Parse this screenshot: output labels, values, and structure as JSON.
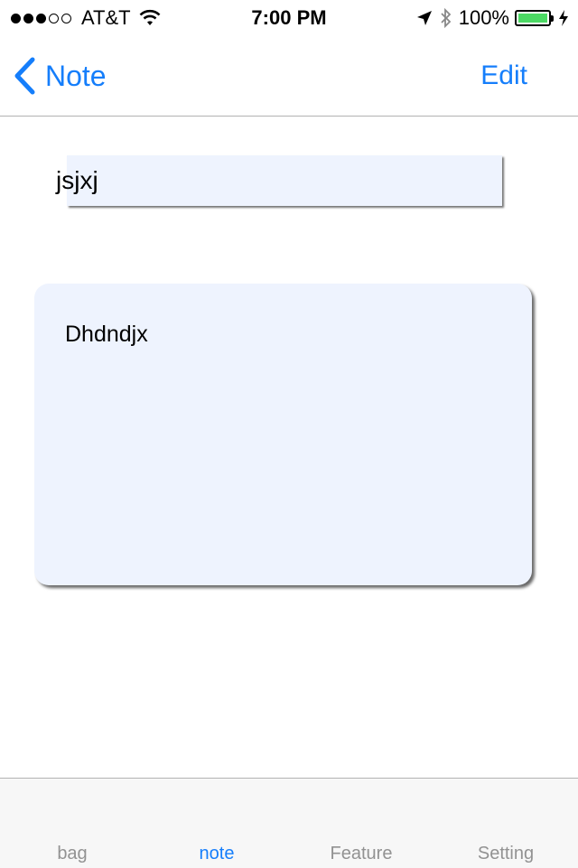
{
  "status_bar": {
    "carrier": "AT&T",
    "time": "7:00 PM",
    "battery_percent_label": "100%",
    "battery_level": 1.0,
    "signal_bars_filled": 3,
    "signal_bars_total": 5
  },
  "nav": {
    "back_label": "Note",
    "edit_label": "Edit"
  },
  "note": {
    "title": "jsjxj",
    "body": "Dhdndjx"
  },
  "tabs": [
    {
      "label": "bag",
      "active": false
    },
    {
      "label": "note",
      "active": true
    },
    {
      "label": "Feature",
      "active": false
    },
    {
      "label": "Setting",
      "active": false
    }
  ],
  "colors": {
    "accent": "#157efb",
    "field_bg": "#eef3fe",
    "battery": "#4cd964",
    "tab_inactive": "#929292"
  }
}
